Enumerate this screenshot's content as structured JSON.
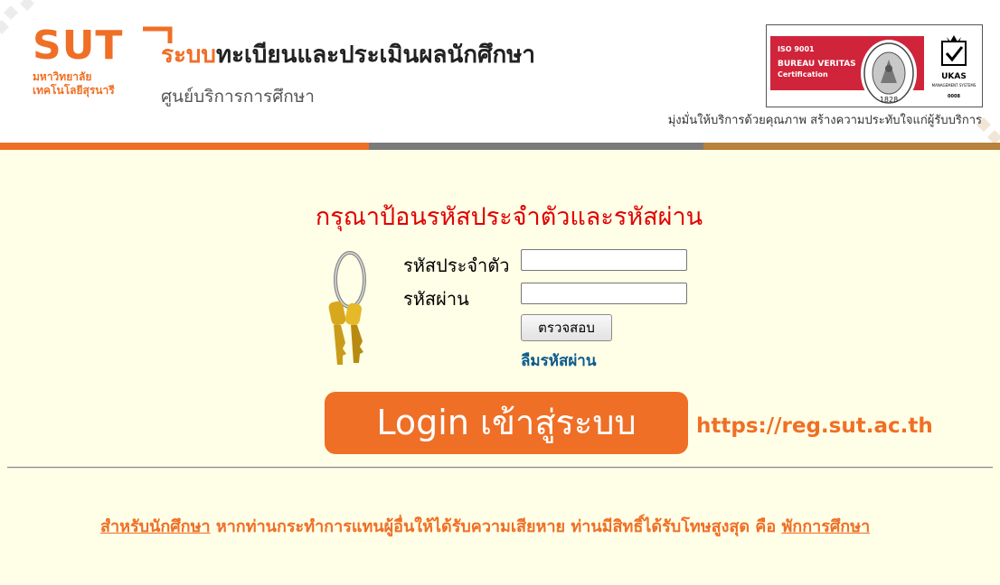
{
  "header": {
    "logo": {
      "brand": "SUT",
      "university_line1": "มหาวิทยาลัย",
      "university_line2": "เทคโนโลยีสุรนารี"
    },
    "system_title_highlight": "ระบบ",
    "system_title_rest": "ทะเบียนและประเมินผลนักศึกษา",
    "system_subtitle": "ศูนย์บริการการศึกษา",
    "certification": {
      "iso": "ISO 9001",
      "company": "BUREAU VERITAS",
      "label": "Certification",
      "seal_year": "1828",
      "ukas": "UKAS",
      "ukas_sub": "MANAGEMENT SYSTEMS",
      "ukas_num": "0008"
    },
    "slogan": "มุ่งมั่นให้บริการด้วยคุณภาพ สร้างความประทับใจแก่ผู้รับบริการ"
  },
  "colors": {
    "brand_orange": "#ef6f26",
    "prompt_red": "#e00000",
    "link_blue": "#0b5a8c",
    "page_bg": "#ffffe7"
  },
  "login": {
    "prompt": "กรุณาป้อนรหัสประจำตัวและรหัสผ่าน",
    "id_label": "รหัสประจำตัว",
    "id_value": "",
    "password_label": "รหัสผ่าน",
    "password_value": "",
    "submit_label": "ตรวจสอบ",
    "forgot_label": "ลืมรหัสผ่าน",
    "icon": "keys-icon"
  },
  "banner": {
    "label": "Login เข้าสู่ระบบ",
    "url": "https://reg.sut.ac.th"
  },
  "notice": {
    "lead_link": "สำหรับนักศึกษา",
    "text": " หากท่านกระทำการแทนผู้อื่นให้ได้รับความเสียหาย ท่านมีสิทธิ์ได้รับโทษสูงสุด คือ ",
    "penalty_link": "พักการศึกษา"
  }
}
